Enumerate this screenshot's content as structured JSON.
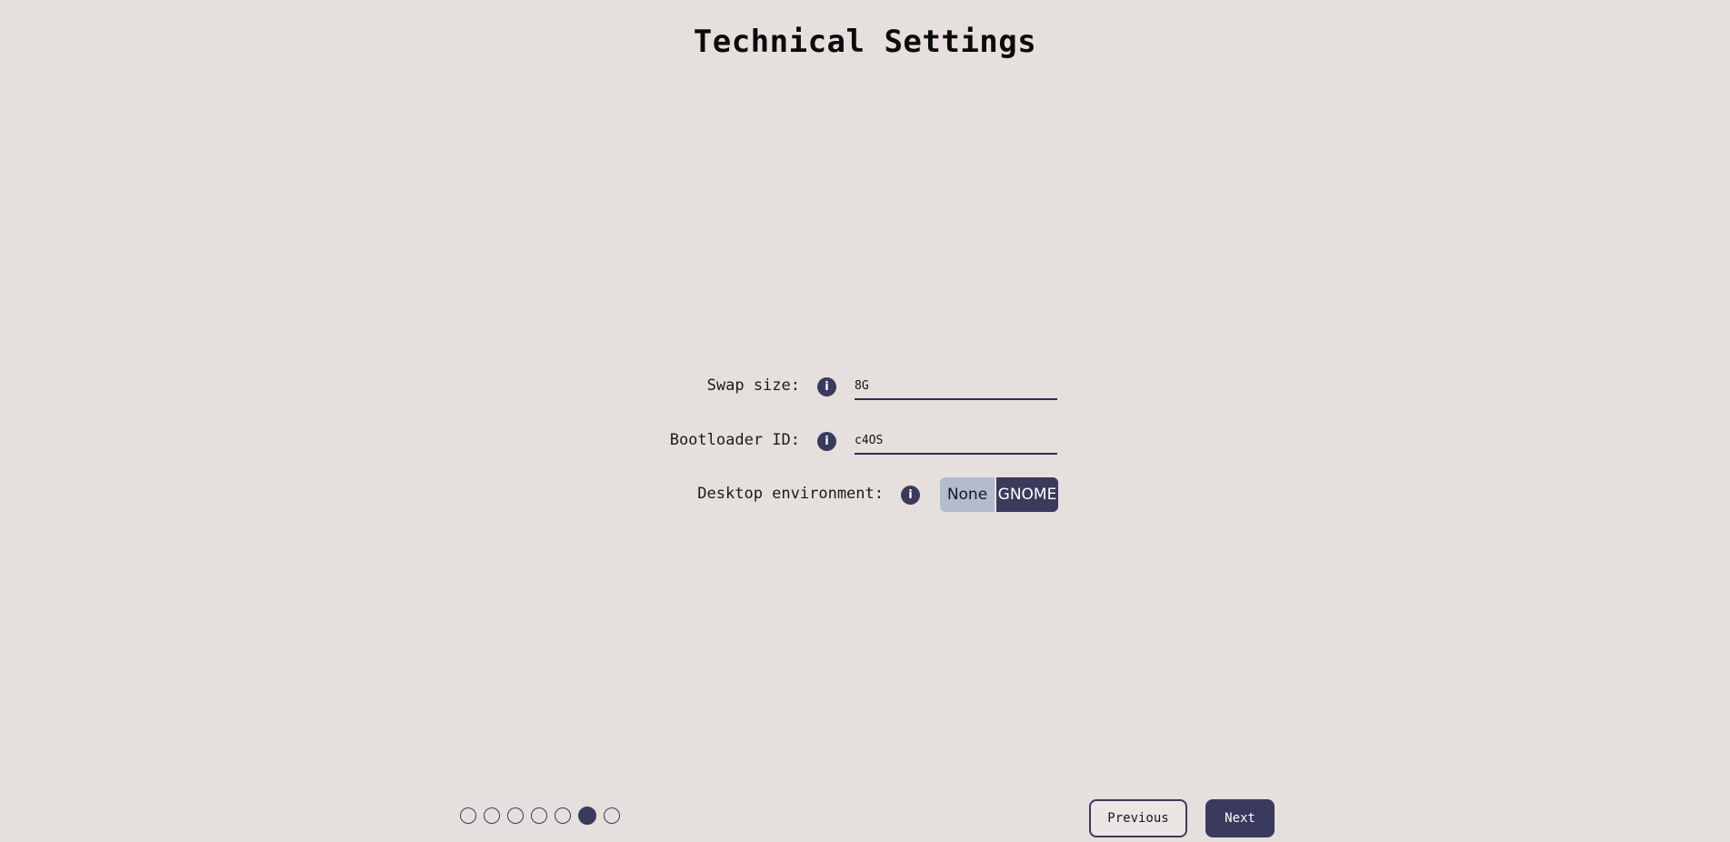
{
  "page": {
    "title": "Technical Settings"
  },
  "form": {
    "swap": {
      "label": "Swap size:",
      "value": "8G",
      "info_icon": "info-icon"
    },
    "bootloader": {
      "label": "Bootloader ID:",
      "value": "c4OS",
      "info_icon": "info-icon"
    },
    "desktop": {
      "label": "Desktop environment:",
      "info_icon": "info-icon",
      "options": [
        "None",
        "GNOME"
      ],
      "selected": "GNOME"
    },
    "info_glyph": "i"
  },
  "progress": {
    "total_steps": 7,
    "current_step": 6
  },
  "nav": {
    "previous_label": "Previous",
    "next_label": "Next"
  },
  "colors": {
    "background": "#e5e0dd",
    "accent": "#3a3a5c",
    "option_inactive": "#b3bccd"
  }
}
